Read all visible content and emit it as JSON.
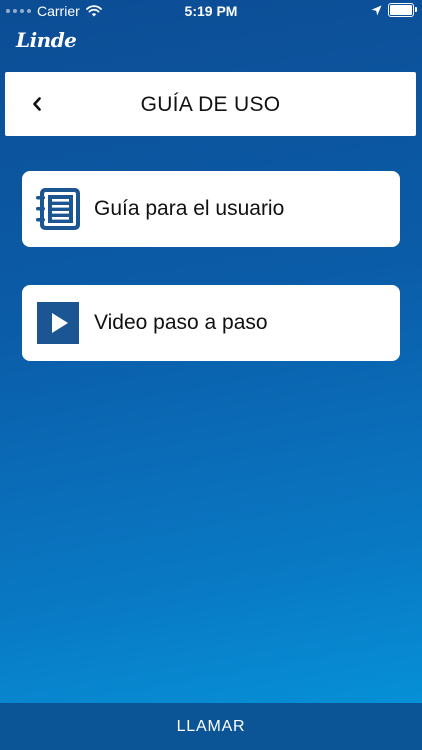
{
  "status_bar": {
    "carrier": "Carrier",
    "time": "5:19 PM"
  },
  "brand": {
    "logo_text": "Linde"
  },
  "header": {
    "title": "GUÍA DE USO"
  },
  "menu": {
    "items": [
      {
        "label": "Guía para el usuario",
        "icon": "notebook-icon"
      },
      {
        "label": "Video paso a paso",
        "icon": "play-icon"
      }
    ]
  },
  "footer": {
    "call_label": "LLAMAR"
  },
  "colors": {
    "brand_blue": "#0b5496",
    "icon_blue": "#1b5592",
    "background_top": "#0c4d95",
    "background_bottom": "#0597dc"
  }
}
